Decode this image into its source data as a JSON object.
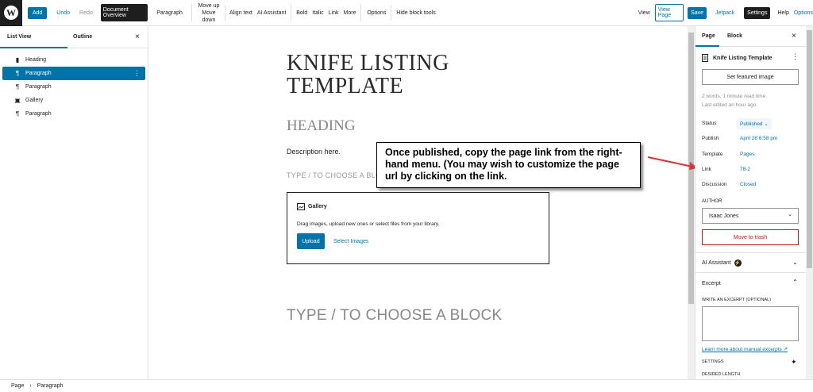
{
  "toolbar": {
    "add": "Add",
    "undo": "Undo",
    "redo": "Redo",
    "document_overview": "Document Overview",
    "paragraph": "Paragraph",
    "move_up": "Move up",
    "move_down": "Move down",
    "align_text": "Align text",
    "ai_assistant": "AI Assistant",
    "bold": "Bold",
    "italic": "Italic",
    "link": "Link",
    "more": "More",
    "options": "Options",
    "hide_block_tools": "Hide block tools",
    "view": "View",
    "view_page": "View Page",
    "save": "Save",
    "jetpack": "Jetpack",
    "settings": "Settings",
    "help": "Help",
    "options_right": "Options"
  },
  "left_panel": {
    "tab_list_view": "List View",
    "tab_outline": "Outline",
    "close": "×",
    "items": [
      {
        "label": "Heading",
        "icon": "bookmark-icon",
        "glyph": "▮"
      },
      {
        "label": "Paragraph",
        "icon": "paragraph-icon",
        "glyph": "¶"
      },
      {
        "label": "Paragraph",
        "icon": "paragraph-icon",
        "glyph": "¶"
      },
      {
        "label": "Gallery",
        "icon": "gallery-icon",
        "glyph": "▣"
      },
      {
        "label": "Paragraph",
        "icon": "paragraph-icon",
        "glyph": "¶"
      }
    ],
    "more_glyph": "⋮"
  },
  "editor": {
    "title": "KNIFE LISTING TEMPLATE",
    "heading": "HEADING",
    "description": "Description here.",
    "placeholder_top": "TYPE / TO CHOOSE A BLO",
    "gallery_title": "Gallery",
    "gallery_desc": "Drag images, upload new ones or select files from your library.",
    "upload": "Upload",
    "select_images": "Select Images",
    "placeholder_bottom": "TYPE / TO CHOOSE A BLOCK"
  },
  "callout": {
    "text": "Once published, copy the page link from the right-hand menu. (You may wish to customize the page url by clicking on the link."
  },
  "right_panel": {
    "tab_page": "Page",
    "tab_block": "Block",
    "close": "×",
    "doc_title": "Knife Listing Template",
    "featured_image": "Set featured image",
    "meta_words": "2 words, 1 minute read time.",
    "meta_edited": "Last edited an hour ago.",
    "status_label": "Status",
    "status_value": "Published",
    "publish_label": "Publish",
    "publish_value": "April 28 6:58 pm",
    "template_label": "Template",
    "template_value": "Pages",
    "link_label": "Link",
    "link_value": "78-2",
    "discussion_label": "Discussion",
    "discussion_value": "Closed",
    "author_heading": "AUTHOR",
    "author_value": "Isaac Jones",
    "move_to_trash": "Move to trash",
    "ai_assistant": "AI Assistant",
    "excerpt": "Excerpt",
    "excerpt_label": "WRITE AN EXCERPT (OPTIONAL)",
    "excerpt_link": "Learn more about manual excerpts ↗",
    "settings_heading": "SETTINGS",
    "desired_length": "DESIRED LENGTH"
  },
  "footer": {
    "crumb_page": "Page",
    "crumb_sep": "›",
    "crumb_paragraph": "Paragraph"
  },
  "colors": {
    "accent": "#0073aa",
    "dark": "#1e1e1e",
    "danger": "#cc1818",
    "callout_arrow": "#d63638"
  }
}
